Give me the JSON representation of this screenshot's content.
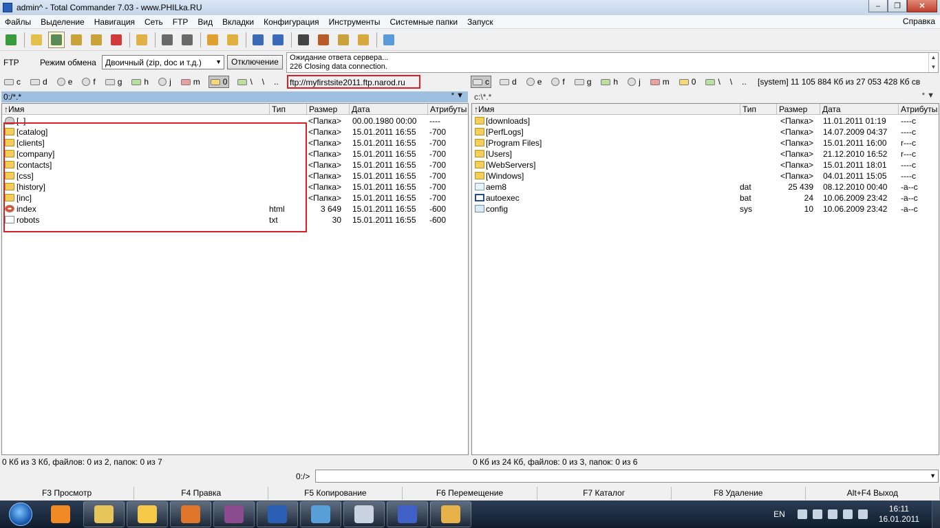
{
  "window": {
    "title": "admin^ - Total Commander 7.03 - www.PHILka.RU",
    "min_icon": "minimize-icon",
    "max_icon": "maximize-icon",
    "close_icon": "close-icon"
  },
  "menu": {
    "items": [
      "Файлы",
      "Выделение",
      "Навигация",
      "Сеть",
      "FTP",
      "Вид",
      "Вкладки",
      "Конфигурация",
      "Инструменты",
      "Системные папки",
      "Запуск"
    ],
    "help": "Справка"
  },
  "toolbar": {
    "icons": [
      "refresh-icon",
      "brief-view-icon",
      "full-view-icon",
      "thumbnail-view-icon",
      "tree-view-icon",
      "invert-selection-icon",
      "compare-icon",
      "back-icon",
      "forward-icon",
      "pack-icon",
      "unpack-icon",
      "ftp-connect-icon",
      "url-connect-icon",
      "search-icon",
      "multi-rename-icon",
      "sync-dirs-icon",
      "copy-names-icon",
      "notepad-icon"
    ],
    "pressed": "full-view-icon"
  },
  "ftp": {
    "label": "FTP",
    "mode_label": "Режим обмена",
    "mode_value": "Двоичный (zip, doc и т.д.)",
    "disconnect_label": "Отключение",
    "log": [
      "Ожидание ответа сервера...",
      "226 Closing data connection."
    ],
    "url": "ftp://myfirstsite2011.ftp.narod.ru"
  },
  "left": {
    "drives": [
      {
        "letter": "c",
        "kind": "hdd"
      },
      {
        "letter": "d",
        "kind": "hdd"
      },
      {
        "letter": "e",
        "kind": "cd"
      },
      {
        "letter": "f",
        "kind": "cd"
      },
      {
        "letter": "g",
        "kind": "hdd"
      },
      {
        "letter": "h",
        "kind": "net"
      },
      {
        "letter": "j",
        "kind": "cd"
      },
      {
        "letter": "m",
        "kind": "rm"
      },
      {
        "letter": "0",
        "kind": "ftp",
        "active": true
      },
      {
        "letter": "\\",
        "kind": "net-tree"
      },
      {
        "letter": "\\",
        "kind": "text"
      },
      {
        "letter": "..",
        "kind": "text"
      }
    ],
    "path": "0:/*.*",
    "path_controls": "*  ▼",
    "columns": [
      "↑Имя",
      "Тип",
      "Размер",
      "Дата",
      "Атрибуты"
    ],
    "files": [
      {
        "icon": "up-dir-icon",
        "name": "[..]",
        "type": "",
        "size": "<Папка>",
        "date": "00.00.1980 00:00",
        "attr": "----"
      },
      {
        "icon": "folder-icon",
        "name": "[catalog]",
        "type": "",
        "size": "<Папка>",
        "date": "15.01.2011 16:55",
        "attr": "-700"
      },
      {
        "icon": "folder-icon",
        "name": "[clients]",
        "type": "",
        "size": "<Папка>",
        "date": "15.01.2011 16:55",
        "attr": "-700"
      },
      {
        "icon": "folder-icon",
        "name": "[company]",
        "type": "",
        "size": "<Папка>",
        "date": "15.01.2011 16:55",
        "attr": "-700"
      },
      {
        "icon": "folder-icon",
        "name": "[contacts]",
        "type": "",
        "size": "<Папка>",
        "date": "15.01.2011 16:55",
        "attr": "-700"
      },
      {
        "icon": "folder-icon",
        "name": "[css]",
        "type": "",
        "size": "<Папка>",
        "date": "15.01.2011 16:55",
        "attr": "-700"
      },
      {
        "icon": "folder-icon",
        "name": "[history]",
        "type": "",
        "size": "<Папка>",
        "date": "15.01.2011 16:55",
        "attr": "-700"
      },
      {
        "icon": "folder-icon",
        "name": "[inc]",
        "type": "",
        "size": "<Папка>",
        "date": "15.01.2011 16:55",
        "attr": "-700"
      },
      {
        "icon": "html-file-icon",
        "name": "index",
        "type": "html",
        "size": "3 649",
        "date": "15.01.2011 16:55",
        "attr": "-600"
      },
      {
        "icon": "text-file-icon",
        "name": "robots",
        "type": "txt",
        "size": "30",
        "date": "15.01.2011 16:55",
        "attr": "-600"
      }
    ],
    "status": "0 Кб из 3 Кб, файлов: 0 из 2, папок: 0 из 7"
  },
  "right": {
    "drives": [
      {
        "letter": "c",
        "kind": "hdd",
        "active": true
      },
      {
        "letter": "d",
        "kind": "hdd"
      },
      {
        "letter": "e",
        "kind": "cd"
      },
      {
        "letter": "f",
        "kind": "cd"
      },
      {
        "letter": "g",
        "kind": "hdd"
      },
      {
        "letter": "h",
        "kind": "net"
      },
      {
        "letter": "j",
        "kind": "cd"
      },
      {
        "letter": "m",
        "kind": "rm"
      },
      {
        "letter": "0",
        "kind": "ftp"
      },
      {
        "letter": "\\",
        "kind": "net-tree"
      },
      {
        "letter": "\\",
        "kind": "text"
      },
      {
        "letter": "..",
        "kind": "text"
      }
    ],
    "drive_info": "[system]  11 105 884 Кб из 27 053 428 Кб св",
    "path": "c:\\*.*",
    "path_controls": "*  ▼",
    "columns": [
      "↑Имя",
      "Тип",
      "Размер",
      "Дата",
      "Атрибуты"
    ],
    "files": [
      {
        "icon": "folder-icon",
        "name": "[downloads]",
        "type": "",
        "size": "<Папка>",
        "date": "11.01.2011 01:19",
        "attr": "----c"
      },
      {
        "icon": "folder-icon",
        "name": "[PerfLogs]",
        "type": "",
        "size": "<Папка>",
        "date": "14.07.2009 04:37",
        "attr": "----c"
      },
      {
        "icon": "folder-icon",
        "name": "[Program Files]",
        "type": "",
        "size": "<Папка>",
        "date": "15.01.2011 16:00",
        "attr": "r---c"
      },
      {
        "icon": "folder-icon",
        "name": "[Users]",
        "type": "",
        "size": "<Папка>",
        "date": "21.12.2010 16:52",
        "attr": "r---c"
      },
      {
        "icon": "folder-icon",
        "name": "[WebServers]",
        "type": "",
        "size": "<Папка>",
        "date": "15.01.2011 18:01",
        "attr": "----c"
      },
      {
        "icon": "folder-icon",
        "name": "[Windows]",
        "type": "",
        "size": "<Папка>",
        "date": "04.01.2011 15:05",
        "attr": "----c"
      },
      {
        "icon": "dat-file-icon",
        "name": "aem8",
        "type": "dat",
        "size": "25 439",
        "date": "08.12.2010 00:40",
        "attr": "-a--c"
      },
      {
        "icon": "bat-file-icon",
        "name": "autoexec",
        "type": "bat",
        "size": "24",
        "date": "10.06.2009 23:42",
        "attr": "-a--c"
      },
      {
        "icon": "sys-file-icon",
        "name": "config",
        "type": "sys",
        "size": "10",
        "date": "10.06.2009 23:42",
        "attr": "-a--c"
      }
    ],
    "status": "0 Кб из 24 Кб, файлов: 0 из 3, папок: 0 из 6"
  },
  "cmdline": {
    "prompt": "0:/>",
    "value": ""
  },
  "fkeys": [
    "F3 Просмотр",
    "F4 Правка",
    "F5 Копирование",
    "F6 Перемещение",
    "F7 Каталог",
    "F8 Удаление",
    "Alt+F4 Выход"
  ],
  "taskbar": {
    "apps": [
      {
        "icon": "media-player-icon",
        "color": "#f08a24",
        "pinned": true
      },
      {
        "icon": "explorer-icon",
        "color": "#e6c55a"
      },
      {
        "icon": "total-commander-icon",
        "color": "#f6c84a"
      },
      {
        "icon": "firefox-icon",
        "color": "#e0762a"
      },
      {
        "icon": "winrar-icon",
        "color": "#8c4a8f"
      },
      {
        "icon": "word-icon",
        "color": "#2b5fb5"
      },
      {
        "icon": "image-viewer-icon",
        "color": "#5aa0d8"
      },
      {
        "icon": "dvd-icon",
        "color": "#c9d4e0"
      },
      {
        "icon": "save-icon",
        "color": "#3f61c8"
      },
      {
        "icon": "paint-icon",
        "color": "#e8b24a"
      }
    ],
    "lang": "EN",
    "tray_icons": [
      "show-hidden-icons-icon",
      "network-error-icon",
      "flag-icon",
      "network-icon",
      "volume-icon"
    ],
    "time": "16:11",
    "date": "16.01.2011"
  },
  "colors": {
    "highlight_box": "#d81f26",
    "active_path": "#9fbfe0",
    "folder": "#f2cf5b"
  }
}
